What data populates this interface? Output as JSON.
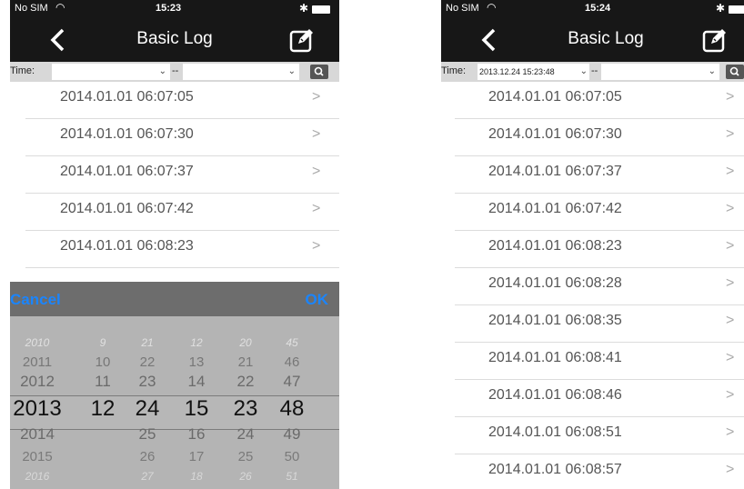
{
  "left": {
    "status": {
      "carrier": "No SIM",
      "time": "15:23"
    },
    "nav": {
      "title": "Basic Log"
    },
    "filter": {
      "label": "Time:",
      "from": "",
      "separator": "--",
      "to": ""
    },
    "rows": [
      {
        "text": "2014.01.01 06:07:05"
      },
      {
        "text": "2014.01.01 06:07:30"
      },
      {
        "text": "2014.01.01 06:07:37"
      },
      {
        "text": "2014.01.01 06:07:42"
      },
      {
        "text": "2014.01.01 06:08:23"
      }
    ],
    "picker": {
      "cancel_label": "Cancel",
      "ok_label": "OK",
      "rows": [
        [
          "2010",
          "9",
          "21",
          "12",
          "20",
          "45"
        ],
        [
          "2011",
          "10",
          "22",
          "13",
          "21",
          "46"
        ],
        [
          "2012",
          "11",
          "23",
          "14",
          "22",
          "47"
        ],
        [
          "2013",
          "12",
          "24",
          "15",
          "23",
          "48"
        ],
        [
          "2014",
          "",
          "25",
          "16",
          "24",
          "49"
        ],
        [
          "2015",
          "",
          "26",
          "17",
          "25",
          "50"
        ],
        [
          "2016",
          "",
          "27",
          "18",
          "26",
          "51"
        ]
      ],
      "selected_row_index": 3
    }
  },
  "right": {
    "status": {
      "carrier": "No SIM",
      "time": "15:24"
    },
    "nav": {
      "title": "Basic Log"
    },
    "filter": {
      "label": "Time:",
      "from": "2013.12.24 15:23:48",
      "separator": "--",
      "to": ""
    },
    "rows": [
      {
        "text": "2014.01.01 06:07:05"
      },
      {
        "text": "2014.01.01 06:07:30"
      },
      {
        "text": "2014.01.01 06:07:37"
      },
      {
        "text": "2014.01.01 06:07:42"
      },
      {
        "text": "2014.01.01 06:08:23"
      },
      {
        "text": "2014.01.01 06:08:28"
      },
      {
        "text": "2014.01.01 06:08:35"
      },
      {
        "text": "2014.01.01 06:08:41"
      },
      {
        "text": "2014.01.01 06:08:46"
      },
      {
        "text": "2014.01.01 06:08:51"
      },
      {
        "text": "2014.01.01 06:08:57"
      }
    ]
  },
  "icons": {
    "back": "chevron-left-icon",
    "edit": "edit-pencil-icon",
    "search": "search-icon",
    "row_chevron": ">",
    "wifi": "wifi-icon",
    "bluetooth": "bluetooth-icon",
    "battery": "battery-icon"
  },
  "colors": {
    "accent": "#1a85ff",
    "navbar": "#171717",
    "filter_bar": "#d8d8d8",
    "picker_toolbar": "#6d6d6d"
  }
}
